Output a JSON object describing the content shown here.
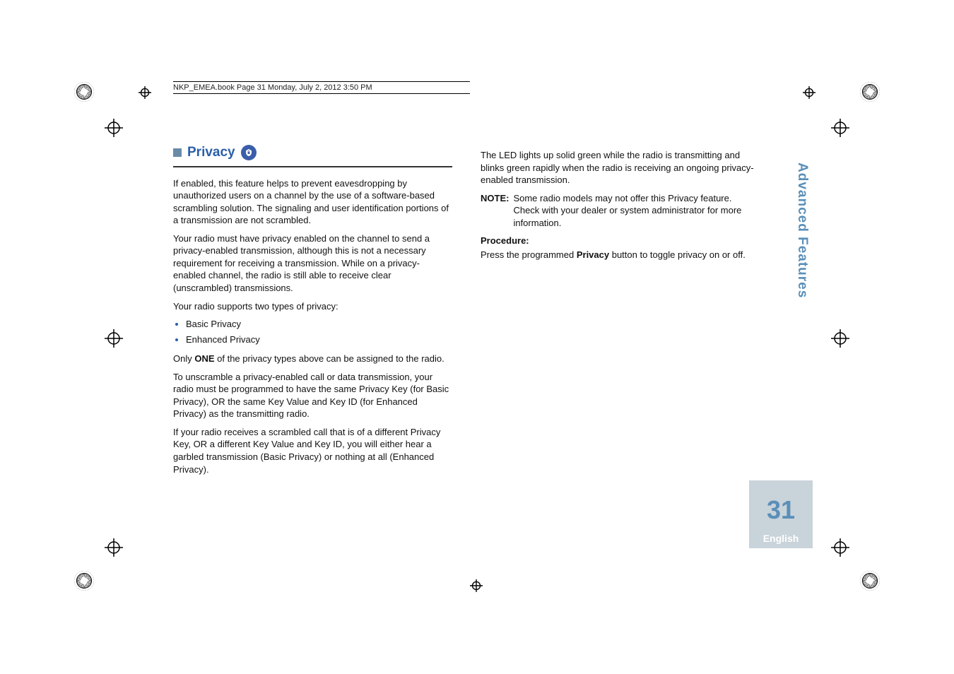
{
  "doc_header": "NKP_EMEA.book  Page 31  Monday, July 2, 2012  3:50 PM",
  "section": {
    "title": "Privacy",
    "p1": "If enabled, this feature helps to prevent eavesdropping by unauthorized users on a channel by the use of a software-based scrambling solution. The signaling and user identification portions of a transmission are not scrambled.",
    "p2": "Your radio must have privacy enabled on the channel to send a privacy-enabled transmission, although this is not a necessary requirement for receiving a transmission. While on a privacy-enabled channel, the radio is still able to receive clear (unscrambled) transmissions.",
    "p3": "Your radio supports two types of privacy:",
    "bullets": [
      "Basic Privacy",
      "Enhanced Privacy"
    ],
    "p4_pre": "Only ",
    "p4_bold": "ONE",
    "p4_post": " of the privacy types above can be assigned to the radio.",
    "p5": "To unscramble a privacy-enabled call or data transmission, your radio must be programmed to have the same Privacy Key (for Basic Privacy), OR the same Key Value and Key ID (for Enhanced Privacy) as the transmitting radio.",
    "p6": "If your radio receives a scrambled call that is of a different Privacy Key, OR a different Key Value and Key ID, you will either hear a garbled transmission (Basic Privacy) or nothing at all (Enhanced Privacy)."
  },
  "right": {
    "p1": "The LED lights up solid green while the radio is transmitting and blinks green rapidly when the radio is receiving an ongoing privacy-enabled transmission.",
    "note_label": "NOTE:",
    "note_text": "Some radio models may not offer this Privacy feature. Check with your dealer or system administrator for more information.",
    "proc_label": "Procedure:",
    "proc_pre": "Press the programmed ",
    "proc_bold": "Privacy",
    "proc_post": " button to toggle privacy on or off."
  },
  "side": {
    "chapter": "Advanced Features",
    "page": "31",
    "language": "English"
  }
}
